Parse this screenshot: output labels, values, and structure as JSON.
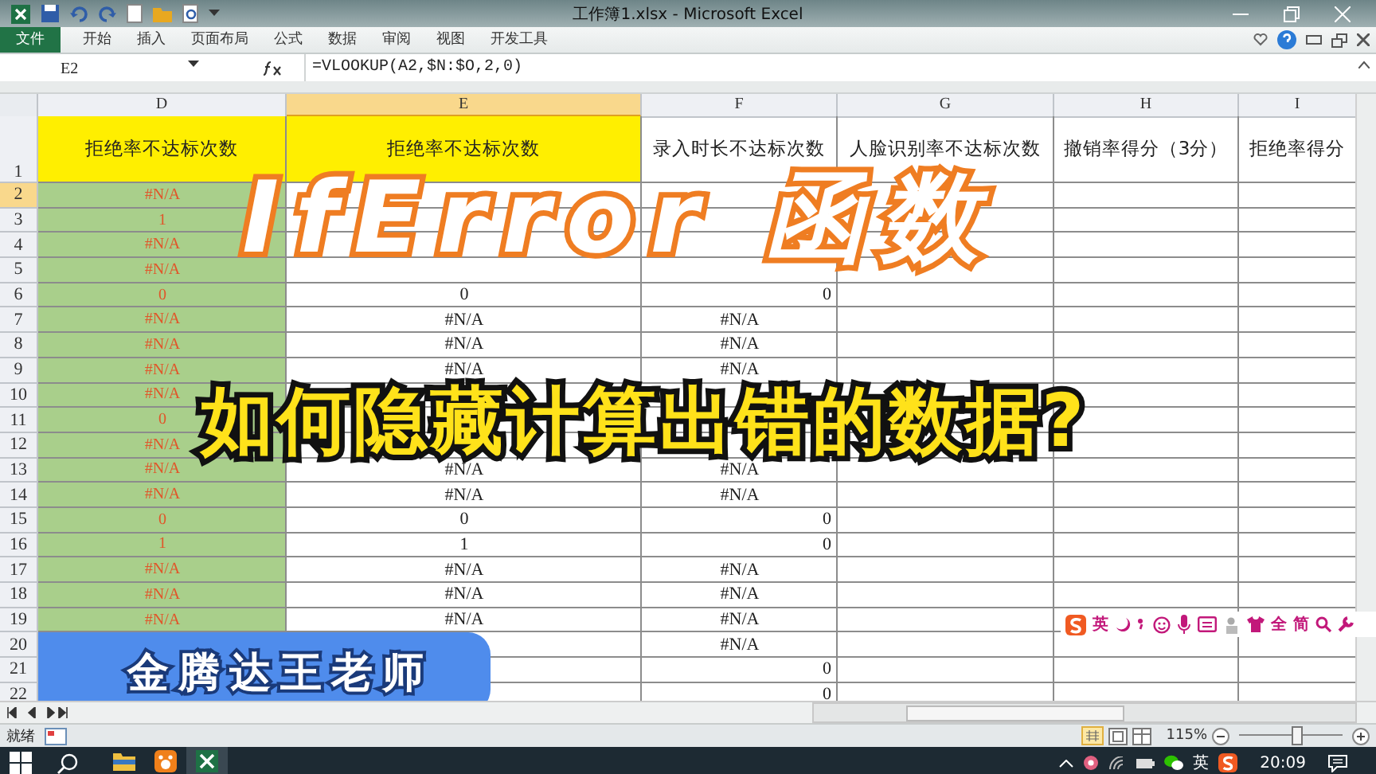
{
  "window": {
    "title": "工作簿1.xlsx - Microsoft Excel"
  },
  "ribbon_tabs": [
    {
      "label": "文件",
      "kind": "file"
    },
    {
      "label": "开始",
      "kind": "tab"
    },
    {
      "label": "插入",
      "kind": "tab"
    },
    {
      "label": "页面布局",
      "kind": "tab"
    },
    {
      "label": "公式",
      "kind": "tab"
    },
    {
      "label": "数据",
      "kind": "tab"
    },
    {
      "label": "审阅",
      "kind": "tab"
    },
    {
      "label": "视图",
      "kind": "tab"
    },
    {
      "label": "开发工具",
      "kind": "tab"
    }
  ],
  "formula_bar": {
    "name_box": "E2",
    "formula": "=VLOOKUP(A2,$N:$O,2,0)"
  },
  "columns": [
    {
      "label": "D",
      "selected": false,
      "kind": "marked"
    },
    {
      "label": "E",
      "selected": true,
      "kind": "plain"
    },
    {
      "label": "F",
      "selected": false,
      "kind": "plain"
    },
    {
      "label": "G",
      "selected": false,
      "kind": "plain"
    },
    {
      "label": "H",
      "selected": false,
      "kind": "plain"
    },
    {
      "label": "I",
      "selected": false,
      "kind": "plain"
    }
  ],
  "header_row": {
    "num": "1",
    "cells": [
      {
        "text": "拒绝率不达标次数",
        "highlight": true
      },
      {
        "text": "拒绝率不达标次数",
        "highlight": true
      },
      {
        "text": "录入时长不达标次数",
        "highlight": false
      },
      {
        "text": "人脸识别率不达标次数",
        "highlight": false
      },
      {
        "text": "撤销率得分（3分）",
        "highlight": false
      },
      {
        "text": "拒绝率得分",
        "highlight": false
      }
    ]
  },
  "rows": [
    {
      "num": "2",
      "selected": true,
      "d": "#N/A"
    },
    {
      "num": "3",
      "selected": false,
      "d": "1"
    },
    {
      "num": "4",
      "selected": false,
      "d": "#N/A"
    },
    {
      "num": "5",
      "selected": false,
      "d": "#N/A"
    },
    {
      "num": "6",
      "selected": false,
      "d": "0",
      "e": "0",
      "f": {
        "text": "0",
        "kind": "number"
      }
    },
    {
      "num": "7",
      "selected": false,
      "d": "#N/A",
      "e": "#N/A",
      "f": {
        "text": "#N/A",
        "kind": "error"
      }
    },
    {
      "num": "8",
      "selected": false,
      "d": "#N/A",
      "e": "#N/A",
      "f": {
        "text": "#N/A",
        "kind": "error"
      }
    },
    {
      "num": "9",
      "selected": false,
      "d": "#N/A",
      "e": "#N/A",
      "f": {
        "text": "#N/A",
        "kind": "error"
      }
    },
    {
      "num": "10",
      "selected": false,
      "d": "#N/A"
    },
    {
      "num": "11",
      "selected": false,
      "d": "0"
    },
    {
      "num": "12",
      "selected": false,
      "d": "#N/A"
    },
    {
      "num": "13",
      "selected": false,
      "d": "#N/A",
      "e": "#N/A",
      "f": {
        "text": "#N/A",
        "kind": "error"
      }
    },
    {
      "num": "14",
      "selected": false,
      "d": "#N/A",
      "e": "#N/A",
      "f": {
        "text": "#N/A",
        "kind": "error"
      }
    },
    {
      "num": "15",
      "selected": false,
      "d": "0",
      "e": "0",
      "f": {
        "text": "0",
        "kind": "number"
      }
    },
    {
      "num": "16",
      "selected": false,
      "d": "1",
      "e": "1",
      "f": {
        "text": "0",
        "kind": "number"
      }
    },
    {
      "num": "17",
      "selected": false,
      "d": "#N/A",
      "e": "#N/A",
      "f": {
        "text": "#N/A",
        "kind": "error"
      }
    },
    {
      "num": "18",
      "selected": false,
      "d": "#N/A",
      "e": "#N/A",
      "f": {
        "text": "#N/A",
        "kind": "error"
      }
    },
    {
      "num": "19",
      "selected": false,
      "d": "#N/A",
      "e": "#N/A",
      "f": {
        "text": "#N/A",
        "kind": "error"
      }
    },
    {
      "num": "20",
      "selected": false,
      "f": {
        "text": "#N/A",
        "kind": "error"
      }
    },
    {
      "num": "21",
      "selected": false,
      "f": {
        "text": "0",
        "kind": "number"
      }
    },
    {
      "num": "22",
      "selected": false,
      "f": {
        "text": "0",
        "kind": "number"
      }
    }
  ],
  "overlays": {
    "headline": "IfError 函数",
    "subtitle": "如何隐藏计算出错的数据?",
    "badge": "金腾达王老师"
  },
  "ime_bar": {
    "mode": "英",
    "width_mode": "全",
    "script": "简"
  },
  "status_bar": {
    "status": "就绪",
    "zoom": "115%",
    "level": 0.55
  },
  "taskbar": {
    "ime": "英",
    "clock": "20:09"
  }
}
